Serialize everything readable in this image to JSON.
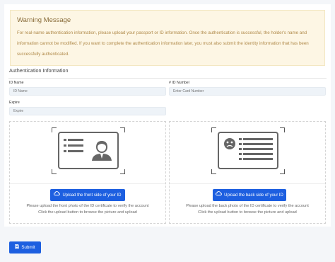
{
  "warning": {
    "title": "Warning Message",
    "line1": "For real-name authentication information, please upload your passport or ID information. Once the authentication is successful, the holder's name and",
    "line2": "information cannot be modified. If you want to complete the authentication information later, you must also submit the identity information that has been",
    "line3": "successfully authenticated."
  },
  "section_title": "Authentication Information",
  "form": {
    "id_name_label": "ID Name",
    "id_name_placeholder": "ID Name",
    "id_number_label": "# ID Numbel",
    "id_number_placeholder": "Enter Card Number",
    "expire_label": "Expire",
    "expire_placeholder": "Expire"
  },
  "upload_front": {
    "button_label": "Upload the front side of your ID",
    "hint_line1": "Please upload the front photo of the ID certificate to verify the account",
    "hint_line2": "Click the upload button to browse the picture and upload"
  },
  "upload_back": {
    "button_label": "Upload the back side of your ID",
    "hint_line1": "Please upload the back photo of the ID certificate to verify the account",
    "hint_line2": "Click the upload button to browse the picture and upload"
  },
  "submit_label": "Submit",
  "colors": {
    "primary": "#1d5fe0",
    "warning_bg": "#fdf6e4",
    "warning_title": "#8a6d3b"
  },
  "icons": [
    "cloud-upload-icon",
    "save-icon",
    "id-card-front-icon",
    "id-card-back-icon"
  ]
}
